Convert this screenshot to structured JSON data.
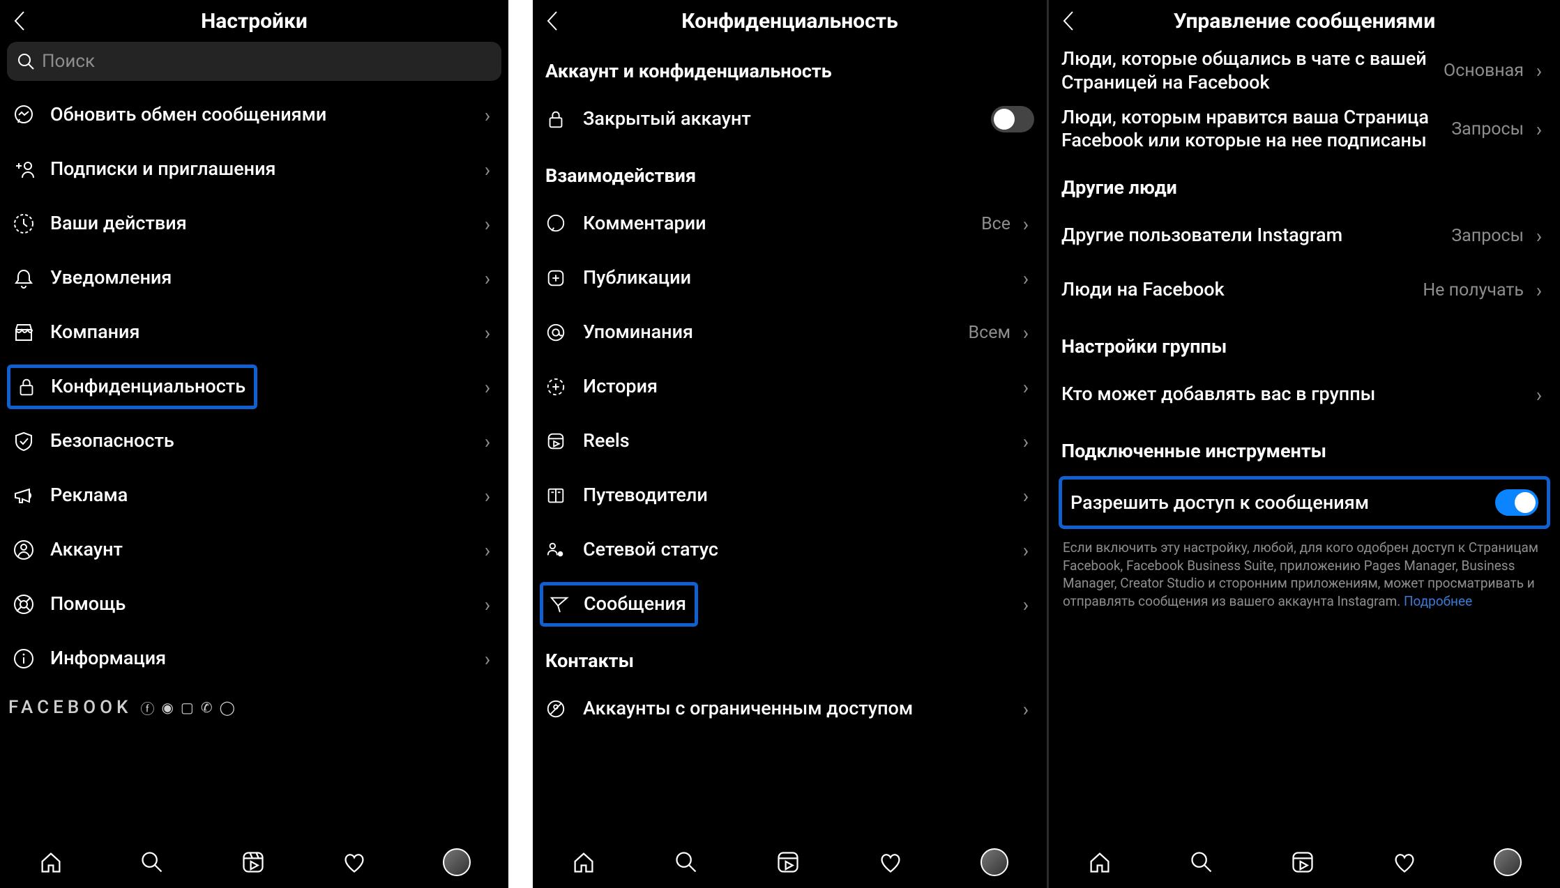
{
  "pane1": {
    "title": "Настройки",
    "search_placeholder": "Поиск",
    "items": [
      {
        "label": "Обновить обмен сообщениями"
      },
      {
        "label": "Подписки и приглашения"
      },
      {
        "label": "Ваши действия"
      },
      {
        "label": "Уведомления"
      },
      {
        "label": "Компания"
      },
      {
        "label": "Конфиденциальность"
      },
      {
        "label": "Безопасность"
      },
      {
        "label": "Реклама"
      },
      {
        "label": "Аккаунт"
      },
      {
        "label": "Помощь"
      },
      {
        "label": "Информация"
      }
    ],
    "footer_brand": "FACEBOOK"
  },
  "pane2": {
    "title": "Конфиденциальность",
    "section_account": "Аккаунт и конфиденциальность",
    "private_account": "Закрытый аккаунт",
    "section_interactions": "Взаимодействия",
    "items": [
      {
        "label": "Комментарии",
        "value": "Все"
      },
      {
        "label": "Публикации"
      },
      {
        "label": "Упоминания",
        "value": "Всем"
      },
      {
        "label": "История"
      },
      {
        "label": "Reels"
      },
      {
        "label": "Путеводители"
      },
      {
        "label": "Сетевой статус"
      },
      {
        "label": "Сообщения"
      }
    ],
    "section_contacts": "Контакты",
    "restricted": "Аккаунты с ограниченным доступом"
  },
  "pane3": {
    "title": "Управление сообщениями",
    "rows_top": [
      {
        "label": "Люди, которые общались в чате с вашей Страницей на Facebook",
        "value": "Основная"
      },
      {
        "label": "Люди, которым нравится ваша Страница Facebook или которые на нее подписаны",
        "value": "Запросы"
      }
    ],
    "section_others": "Другие люди",
    "rows_others": [
      {
        "label": "Другие пользователи Instagram",
        "value": "Запросы"
      },
      {
        "label": "Люди на Facebook",
        "value": "Не получать"
      }
    ],
    "section_group": "Настройки группы",
    "group_row": "Кто может добавлять вас в группы",
    "section_tools": "Подключенные инструменты",
    "allow_label": "Разрешить доступ к сообщениям",
    "help": "Если включить эту настройку, любой, для кого одобрен доступ к Страницам Facebook, Facebook Business Suite, приложению Pages Manager, Business Manager, Creator Studio и сторонним приложениям, может просматривать и отправлять сообщения из вашего аккаунта Instagram. ",
    "more": "Подробнее"
  }
}
